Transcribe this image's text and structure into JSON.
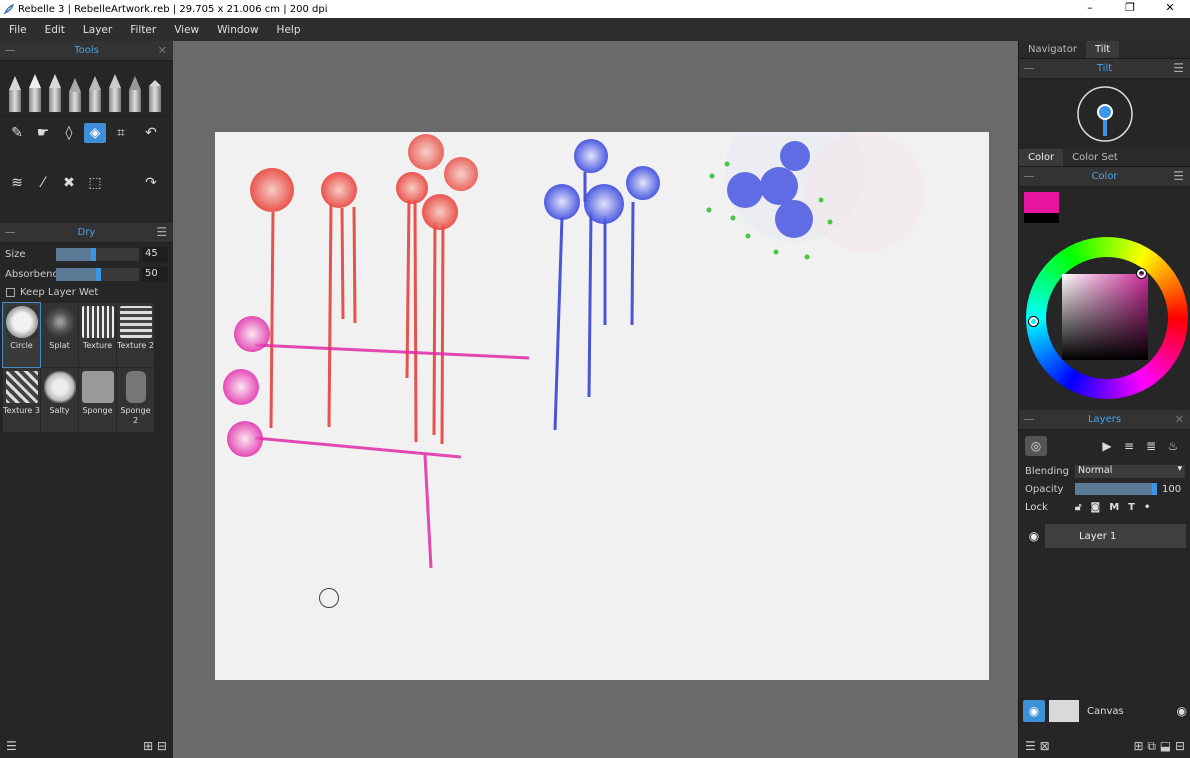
{
  "window": {
    "title": "Rebelle 3 | RebelleArtwork.reb | 29.705 x 21.006 cm | 200 dpi",
    "minimize": "–",
    "restore": "❐",
    "close": "✕"
  },
  "menu": [
    "File",
    "Edit",
    "Layer",
    "Filter",
    "View",
    "Window",
    "Help"
  ],
  "tools_panel": {
    "title": "Tools",
    "close": "✕"
  },
  "brush_panel": {
    "title": "Dry",
    "menu": "☰",
    "size_label": "Size",
    "size_value": "45",
    "size_fraction": 0.45,
    "absorbency_label": "Absorbency",
    "absorbency_value": "50",
    "absorbency_fraction": 0.5,
    "keep_wet_label": "Keep Layer Wet",
    "presets": [
      {
        "label": "Circle"
      },
      {
        "label": "Splat"
      },
      {
        "label": "Texture"
      },
      {
        "label": "Texture 2"
      },
      {
        "label": "Texture 3"
      },
      {
        "label": "Salty"
      },
      {
        "label": "Sponge"
      },
      {
        "label": "Sponge 2"
      }
    ]
  },
  "right": {
    "tabs_top": [
      "Navigator",
      "Tilt"
    ],
    "tilt_title": "Tilt",
    "tabs_color": [
      "Color",
      "Color Set"
    ],
    "color_title": "Color",
    "foreground_color": "#e6149e",
    "background_color": "#000000",
    "layers_title": "Layers",
    "blending_label": "Blending",
    "blending_value": "Normal",
    "opacity_label": "Opacity",
    "opacity_value": "100",
    "lock_label": "Lock",
    "lock_options": [
      "M",
      "T"
    ],
    "layer_name": "Layer 1",
    "canvas_name": "Canvas"
  }
}
